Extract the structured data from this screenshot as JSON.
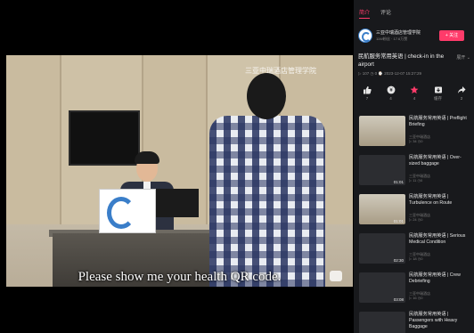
{
  "video": {
    "watermark": "三亚中瑞酒店管理学院",
    "subtitle": "Please show me your health QR code."
  },
  "sidebar": {
    "tabs": [
      {
        "label": "简介",
        "active": true
      },
      {
        "label": "评论",
        "active": false
      }
    ],
    "channel": {
      "name": "三亚中瑞酒店管理学院",
      "meta": "11W粉丝 · 17.6万赞",
      "follow_label": "+ 关注"
    },
    "video_title": "民航服务常用英语 | check-in in the airport",
    "expand_label": "展开",
    "stats": "▷ 107   ◷ 0   ⌚ 2023-12-07 15:27:29",
    "actions": [
      {
        "icon": "thumb-up-icon",
        "count": "7"
      },
      {
        "icon": "coin-icon",
        "count": "4"
      },
      {
        "icon": "star-icon",
        "count": "4"
      },
      {
        "icon": "cache-icon",
        "count": "缓存"
      },
      {
        "icon": "share-icon",
        "count": "2"
      }
    ],
    "recommendations": [
      {
        "title": "民航服务常用英语 | Preflight Briefing",
        "channel": "三亚中瑞酒店",
        "views": "▷ 34  ◷0",
        "duration": "",
        "has_scene": true
      },
      {
        "title": "民航服务常用英语 | Over-sized baggage",
        "channel": "三亚中瑞酒店",
        "views": "▷ 11  ◷0",
        "duration": "01:01",
        "has_scene": false
      },
      {
        "title": "民航服务常用英语 | Turbulence on Route",
        "channel": "三亚中瑞酒店",
        "views": "▷ 24  ◷0",
        "duration": "01:01",
        "has_scene": true
      },
      {
        "title": "民航服务常用英语 | Serious Medical Condition",
        "channel": "三亚中瑞酒店",
        "views": "▷ 18  ◷0",
        "duration": "02:30",
        "has_scene": false
      },
      {
        "title": "民航服务常用英语 | Crew Debriefing",
        "channel": "三亚中瑞酒店",
        "views": "▷ 16  ◷0",
        "duration": "03:08",
        "has_scene": false
      },
      {
        "title": "民航服务常用英语 | Passengers with Heavy Baggage",
        "channel": "",
        "views": "",
        "duration": "",
        "has_scene": false
      }
    ]
  },
  "colors": {
    "accent": "#ff3b6a",
    "sidebar_bg": "#18191c",
    "video_bg": "#000000"
  }
}
